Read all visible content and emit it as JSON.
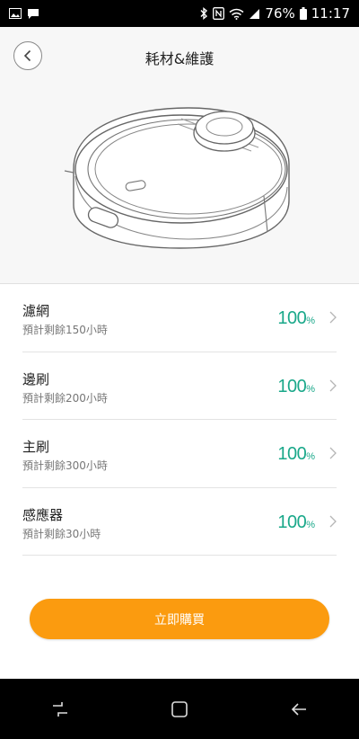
{
  "status_bar": {
    "battery": "76%",
    "time": "11:17"
  },
  "header": {
    "title": "耗材&維護"
  },
  "consumables": [
    {
      "name": "濾網",
      "remaining": "預計剩餘150小時",
      "percent": "100",
      "unit": "%"
    },
    {
      "name": "邊刷",
      "remaining": "預計剩餘200小時",
      "percent": "100",
      "unit": "%"
    },
    {
      "name": "主刷",
      "remaining": "預計剩餘300小時",
      "percent": "100",
      "unit": "%"
    },
    {
      "name": "感應器",
      "remaining": "預計剩餘30小時",
      "percent": "100",
      "unit": "%"
    }
  ],
  "buy_button": {
    "label": "立即購買"
  },
  "colors": {
    "accent_orange": "#fb9b0f",
    "percent_green": "#1aa88a"
  }
}
